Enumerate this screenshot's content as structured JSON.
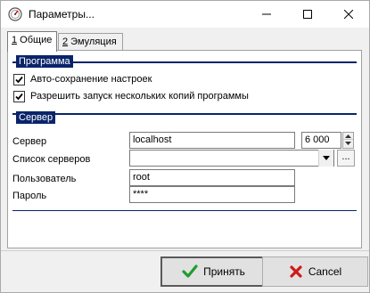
{
  "window": {
    "title": "Параметры..."
  },
  "tabs": [
    {
      "num": "1",
      "label": " Общие"
    },
    {
      "num": "2",
      "label": " Эмуляция"
    }
  ],
  "sections": {
    "program": "Программа",
    "server": "Сервер"
  },
  "checkboxes": [
    {
      "label": "Авто-сохранение настроек",
      "checked": true
    },
    {
      "label": "Разрешить запуск нескольких копий программы",
      "checked": true
    }
  ],
  "fields": {
    "server": {
      "label": "Сервер",
      "value": "localhost",
      "port": "6 000"
    },
    "server_list": {
      "label": "Список серверов",
      "value": "",
      "browse": "..."
    },
    "user": {
      "label": "Пользователь",
      "value": "root"
    },
    "password": {
      "label": "Пароль",
      "value": "****"
    }
  },
  "buttons": {
    "ok": "Принять",
    "cancel": "Cancel"
  },
  "colors": {
    "section_bg": "#0a246a",
    "ok_icon": "#1e9e2e",
    "cancel_icon": "#d01818"
  }
}
